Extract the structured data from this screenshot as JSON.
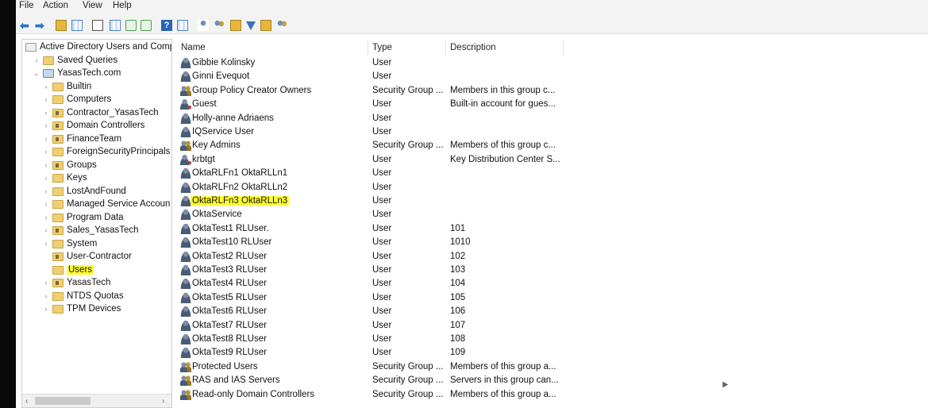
{
  "menu": [
    "File",
    "Action",
    "View",
    "Help"
  ],
  "toolbar": {
    "icons": [
      "back-arrow-icon",
      "forward-arrow-icon",
      "up-folder-icon",
      "show-tree-icon",
      "properties-icon",
      "export-list-icon",
      "refresh-icon",
      "export-icon",
      "help-icon",
      "view-icon",
      "new-user-icon",
      "new-group-icon",
      "new-ou-icon",
      "filter-icon",
      "add-to-group-icon",
      "delegate-icon"
    ]
  },
  "tree": {
    "items": [
      {
        "label": "Active Directory Users and Comp",
        "level": 0,
        "expander": "",
        "icon": "root"
      },
      {
        "label": "Saved Queries",
        "level": 1,
        "expander": "›",
        "icon": "folder"
      },
      {
        "label": "YasasTech.com",
        "level": 1,
        "expander": "⌄",
        "icon": "domain"
      },
      {
        "label": "Builtin",
        "level": 2,
        "expander": "›",
        "icon": "folder"
      },
      {
        "label": "Computers",
        "level": 2,
        "expander": "›",
        "icon": "folder"
      },
      {
        "label": "Contractor_YasasTech",
        "level": 2,
        "expander": "›",
        "icon": "ou"
      },
      {
        "label": "Domain Controllers",
        "level": 2,
        "expander": "›",
        "icon": "ou"
      },
      {
        "label": "FinanceTeam",
        "level": 2,
        "expander": "›",
        "icon": "ou"
      },
      {
        "label": "ForeignSecurityPrincipals",
        "level": 2,
        "expander": "›",
        "icon": "folder"
      },
      {
        "label": "Groups",
        "level": 2,
        "expander": "›",
        "icon": "ou"
      },
      {
        "label": "Keys",
        "level": 2,
        "expander": "›",
        "icon": "folder"
      },
      {
        "label": "LostAndFound",
        "level": 2,
        "expander": "›",
        "icon": "folder"
      },
      {
        "label": "Managed Service Accoun",
        "level": 2,
        "expander": "›",
        "icon": "folder"
      },
      {
        "label": "Program Data",
        "level": 2,
        "expander": "›",
        "icon": "folder"
      },
      {
        "label": "Sales_YasasTech",
        "level": 2,
        "expander": "›",
        "icon": "ou"
      },
      {
        "label": "System",
        "level": 2,
        "expander": "›",
        "icon": "folder"
      },
      {
        "label": "User-Contractor",
        "level": 2,
        "expander": "",
        "icon": "ou"
      },
      {
        "label": "Users",
        "level": 2,
        "expander": "",
        "icon": "folder",
        "highlight": true
      },
      {
        "label": "YasasTech",
        "level": 2,
        "expander": "›",
        "icon": "ou"
      },
      {
        "label": "NTDS Quotas",
        "level": 2,
        "expander": "›",
        "icon": "folder"
      },
      {
        "label": "TPM Devices",
        "level": 2,
        "expander": "›",
        "icon": "folder"
      }
    ],
    "scroll_left": "‹",
    "scroll_right": "›"
  },
  "list": {
    "columns": {
      "name": "Name",
      "type": "Type",
      "description": "Description"
    },
    "rows": [
      {
        "name": "Gibbie Kolinsky",
        "type": "User",
        "description": "",
        "icon": "user"
      },
      {
        "name": "Ginni Evequot",
        "type": "User",
        "description": "",
        "icon": "user"
      },
      {
        "name": "Group Policy Creator Owners",
        "type": "Security Group ...",
        "description": "Members in this group c...",
        "icon": "group"
      },
      {
        "name": "Guest",
        "type": "User",
        "description": "Built-in account for gues...",
        "icon": "special"
      },
      {
        "name": "Holly-anne Adriaens",
        "type": "User",
        "description": "",
        "icon": "user"
      },
      {
        "name": "IQService User",
        "type": "User",
        "description": "",
        "icon": "user"
      },
      {
        "name": "Key Admins",
        "type": "Security Group ...",
        "description": "Members of this group c...",
        "icon": "group"
      },
      {
        "name": "krbtgt",
        "type": "User",
        "description": "Key Distribution Center S...",
        "icon": "special"
      },
      {
        "name": "OktaRLFn1 OktaRLLn1",
        "type": "User",
        "description": "",
        "icon": "user"
      },
      {
        "name": "OktaRLFn2 OktaRLLn2",
        "type": "User",
        "description": "",
        "icon": "user"
      },
      {
        "name": "OktaRLFn3 OktaRLLn3",
        "type": "User",
        "description": "",
        "icon": "user",
        "highlight": true
      },
      {
        "name": "OktaService",
        "type": "User",
        "description": "",
        "icon": "user"
      },
      {
        "name": "OktaTest1 RLUser.",
        "type": "User",
        "description": "101",
        "icon": "user"
      },
      {
        "name": "OktaTest10 RLUser",
        "type": "User",
        "description": "1010",
        "icon": "user"
      },
      {
        "name": "OktaTest2 RLUser",
        "type": "User",
        "description": "102",
        "icon": "user"
      },
      {
        "name": "OktaTest3 RLUser",
        "type": "User",
        "description": "103",
        "icon": "user"
      },
      {
        "name": "OktaTest4 RLUser",
        "type": "User",
        "description": "104",
        "icon": "user"
      },
      {
        "name": "OktaTest5 RLUser",
        "type": "User",
        "description": "105",
        "icon": "user"
      },
      {
        "name": "OktaTest6 RLUser",
        "type": "User",
        "description": "106",
        "icon": "user"
      },
      {
        "name": "OktaTest7 RLUser",
        "type": "User",
        "description": "107",
        "icon": "user"
      },
      {
        "name": "OktaTest8 RLUser",
        "type": "User",
        "description": "108",
        "icon": "user"
      },
      {
        "name": "OktaTest9 RLUser",
        "type": "User",
        "description": "109",
        "icon": "user"
      },
      {
        "name": "Protected Users",
        "type": "Security Group ...",
        "description": "Members of this group a...",
        "icon": "group"
      },
      {
        "name": "RAS and IAS Servers",
        "type": "Security Group ...",
        "description": "Servers in this group can...",
        "icon": "group"
      },
      {
        "name": "Read-only Domain Controllers",
        "type": "Security Group ...",
        "description": "Members of this group a...",
        "icon": "group"
      }
    ]
  }
}
